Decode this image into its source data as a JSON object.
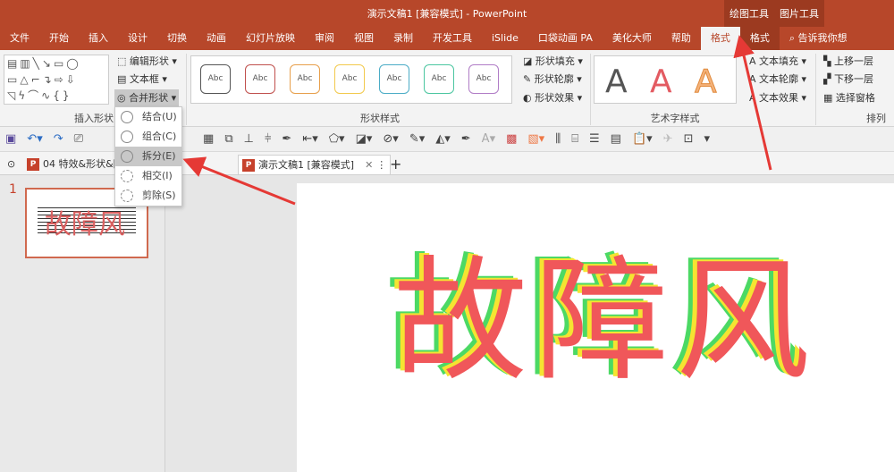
{
  "window": {
    "title": "演示文稿1 [兼容模式] - PowerPoint",
    "context_tabs": [
      "绘图工具",
      "图片工具"
    ]
  },
  "tabs": [
    "文件",
    "开始",
    "插入",
    "设计",
    "切换",
    "动画",
    "幻灯片放映",
    "审阅",
    "视图",
    "录制",
    "开发工具",
    "iSlide",
    "口袋动画 PA",
    "美化大师",
    "帮助",
    "格式",
    "格式"
  ],
  "active_tab": "格式",
  "tell_me": "告诉我你想",
  "ribbon": {
    "insert_shapes": {
      "label": "插入形状",
      "edit_shape": "编辑形状",
      "text_box": "文本框",
      "merge_shapes": "合并形状"
    },
    "shape_styles": {
      "label": "形状样式",
      "sample": "Abc",
      "colors": [
        "#555555",
        "#c0504d",
        "#e79f4b",
        "#f2c94c",
        "#4bacc6",
        "#4bc6a0",
        "#b07cc6"
      ],
      "fill": "形状填充",
      "outline": "形状轮廓",
      "effects": "形状效果"
    },
    "wordart": {
      "label": "艺术字样式",
      "sample": "A",
      "text_fill": "文本填充",
      "text_outline": "文本轮廓",
      "text_effects": "文本效果"
    },
    "arrange": {
      "label": "排列",
      "bring_forward": "上移一层",
      "send_backward": "下移一层",
      "selection_pane": "选择窗格"
    }
  },
  "merge_menu": [
    {
      "label": "结合(U)"
    },
    {
      "label": "组合(C)"
    },
    {
      "label": "拆分(E)",
      "highlighted": true
    },
    {
      "label": "相交(I)"
    },
    {
      "label": "剪除(S)"
    }
  ],
  "doc_tabs": [
    {
      "label": "04 特效&形状&图..."
    },
    {
      "label": "演示文稿1 [兼容模式]",
      "active": true
    }
  ],
  "slides": {
    "number": "1",
    "thumb_text": "故障风"
  },
  "slide": {
    "text": "故障风",
    "colors": {
      "main": "#f0575a",
      "yellow": "#f5e431",
      "green": "#4cd964"
    }
  },
  "accent": "#b7472a"
}
